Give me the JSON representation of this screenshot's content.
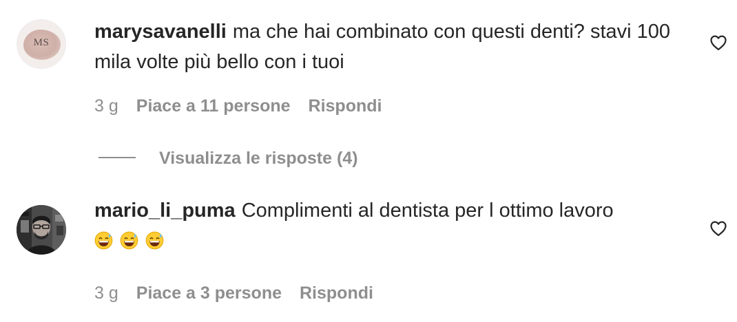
{
  "comments": [
    {
      "username": "marysavanelli",
      "text": "ma che hai combinato con questi denti? stavi 100 mila volte più bello con i tuoi",
      "avatar_monogram": "MS",
      "time": "3 g",
      "likes": "Piace a 11 persone",
      "reply": "Rispondi",
      "view_replies": "Visualizza le risposte (4)"
    },
    {
      "username": "mario_li_puma",
      "text": "Complimenti al dentista per l ottimo lavoro",
      "emoji": "😅😅😅",
      "time": "3 g",
      "likes": "Piace a 3 persone",
      "reply": "Rispondi"
    }
  ],
  "icons": {
    "like": "heart-outline-icon"
  },
  "colors": {
    "text": "#262626",
    "secondary": "#8e8e8e",
    "background": "#ffffff"
  }
}
